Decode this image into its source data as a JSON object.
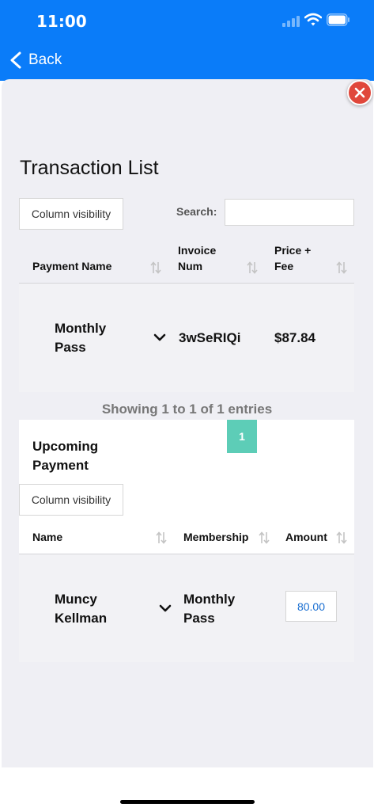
{
  "status_bar": {
    "time": "11:00"
  },
  "nav": {
    "back_label": "Back"
  },
  "page": {
    "title": "Transaction List"
  },
  "transactions_table": {
    "column_visibility_label": "Column visibility",
    "search_label": "Search:",
    "search_value": "",
    "columns": [
      "Payment Name",
      "Invoice Num",
      "Price + Fee"
    ],
    "rows": [
      {
        "payment_name": "Monthly Pass",
        "invoice_num": "3wSeRIQi",
        "price_fee": "$87.84"
      }
    ],
    "info": "Showing 1 to 1 of 1 entries",
    "current_page": "1"
  },
  "upcoming_payment": {
    "title": "Upcoming Payment",
    "column_visibility_label": "Column visibility",
    "columns": [
      "Name",
      "Membership",
      "Amount"
    ],
    "rows": [
      {
        "name": "Muncy Kellman",
        "membership": "Monthly Pass",
        "amount": "80.00"
      }
    ]
  },
  "colors": {
    "nav_blue": "#0a7cf9",
    "close_red": "#e0473b",
    "pagination_teal": "#5dcdb7",
    "sheet_background": "#efeff4",
    "amount_blue": "#1a6fd1"
  },
  "icons": [
    "back-chevron-icon",
    "close-icon",
    "sort-icon",
    "chevron-down-icon",
    "signal-icon",
    "wifi-icon",
    "battery-icon"
  ]
}
